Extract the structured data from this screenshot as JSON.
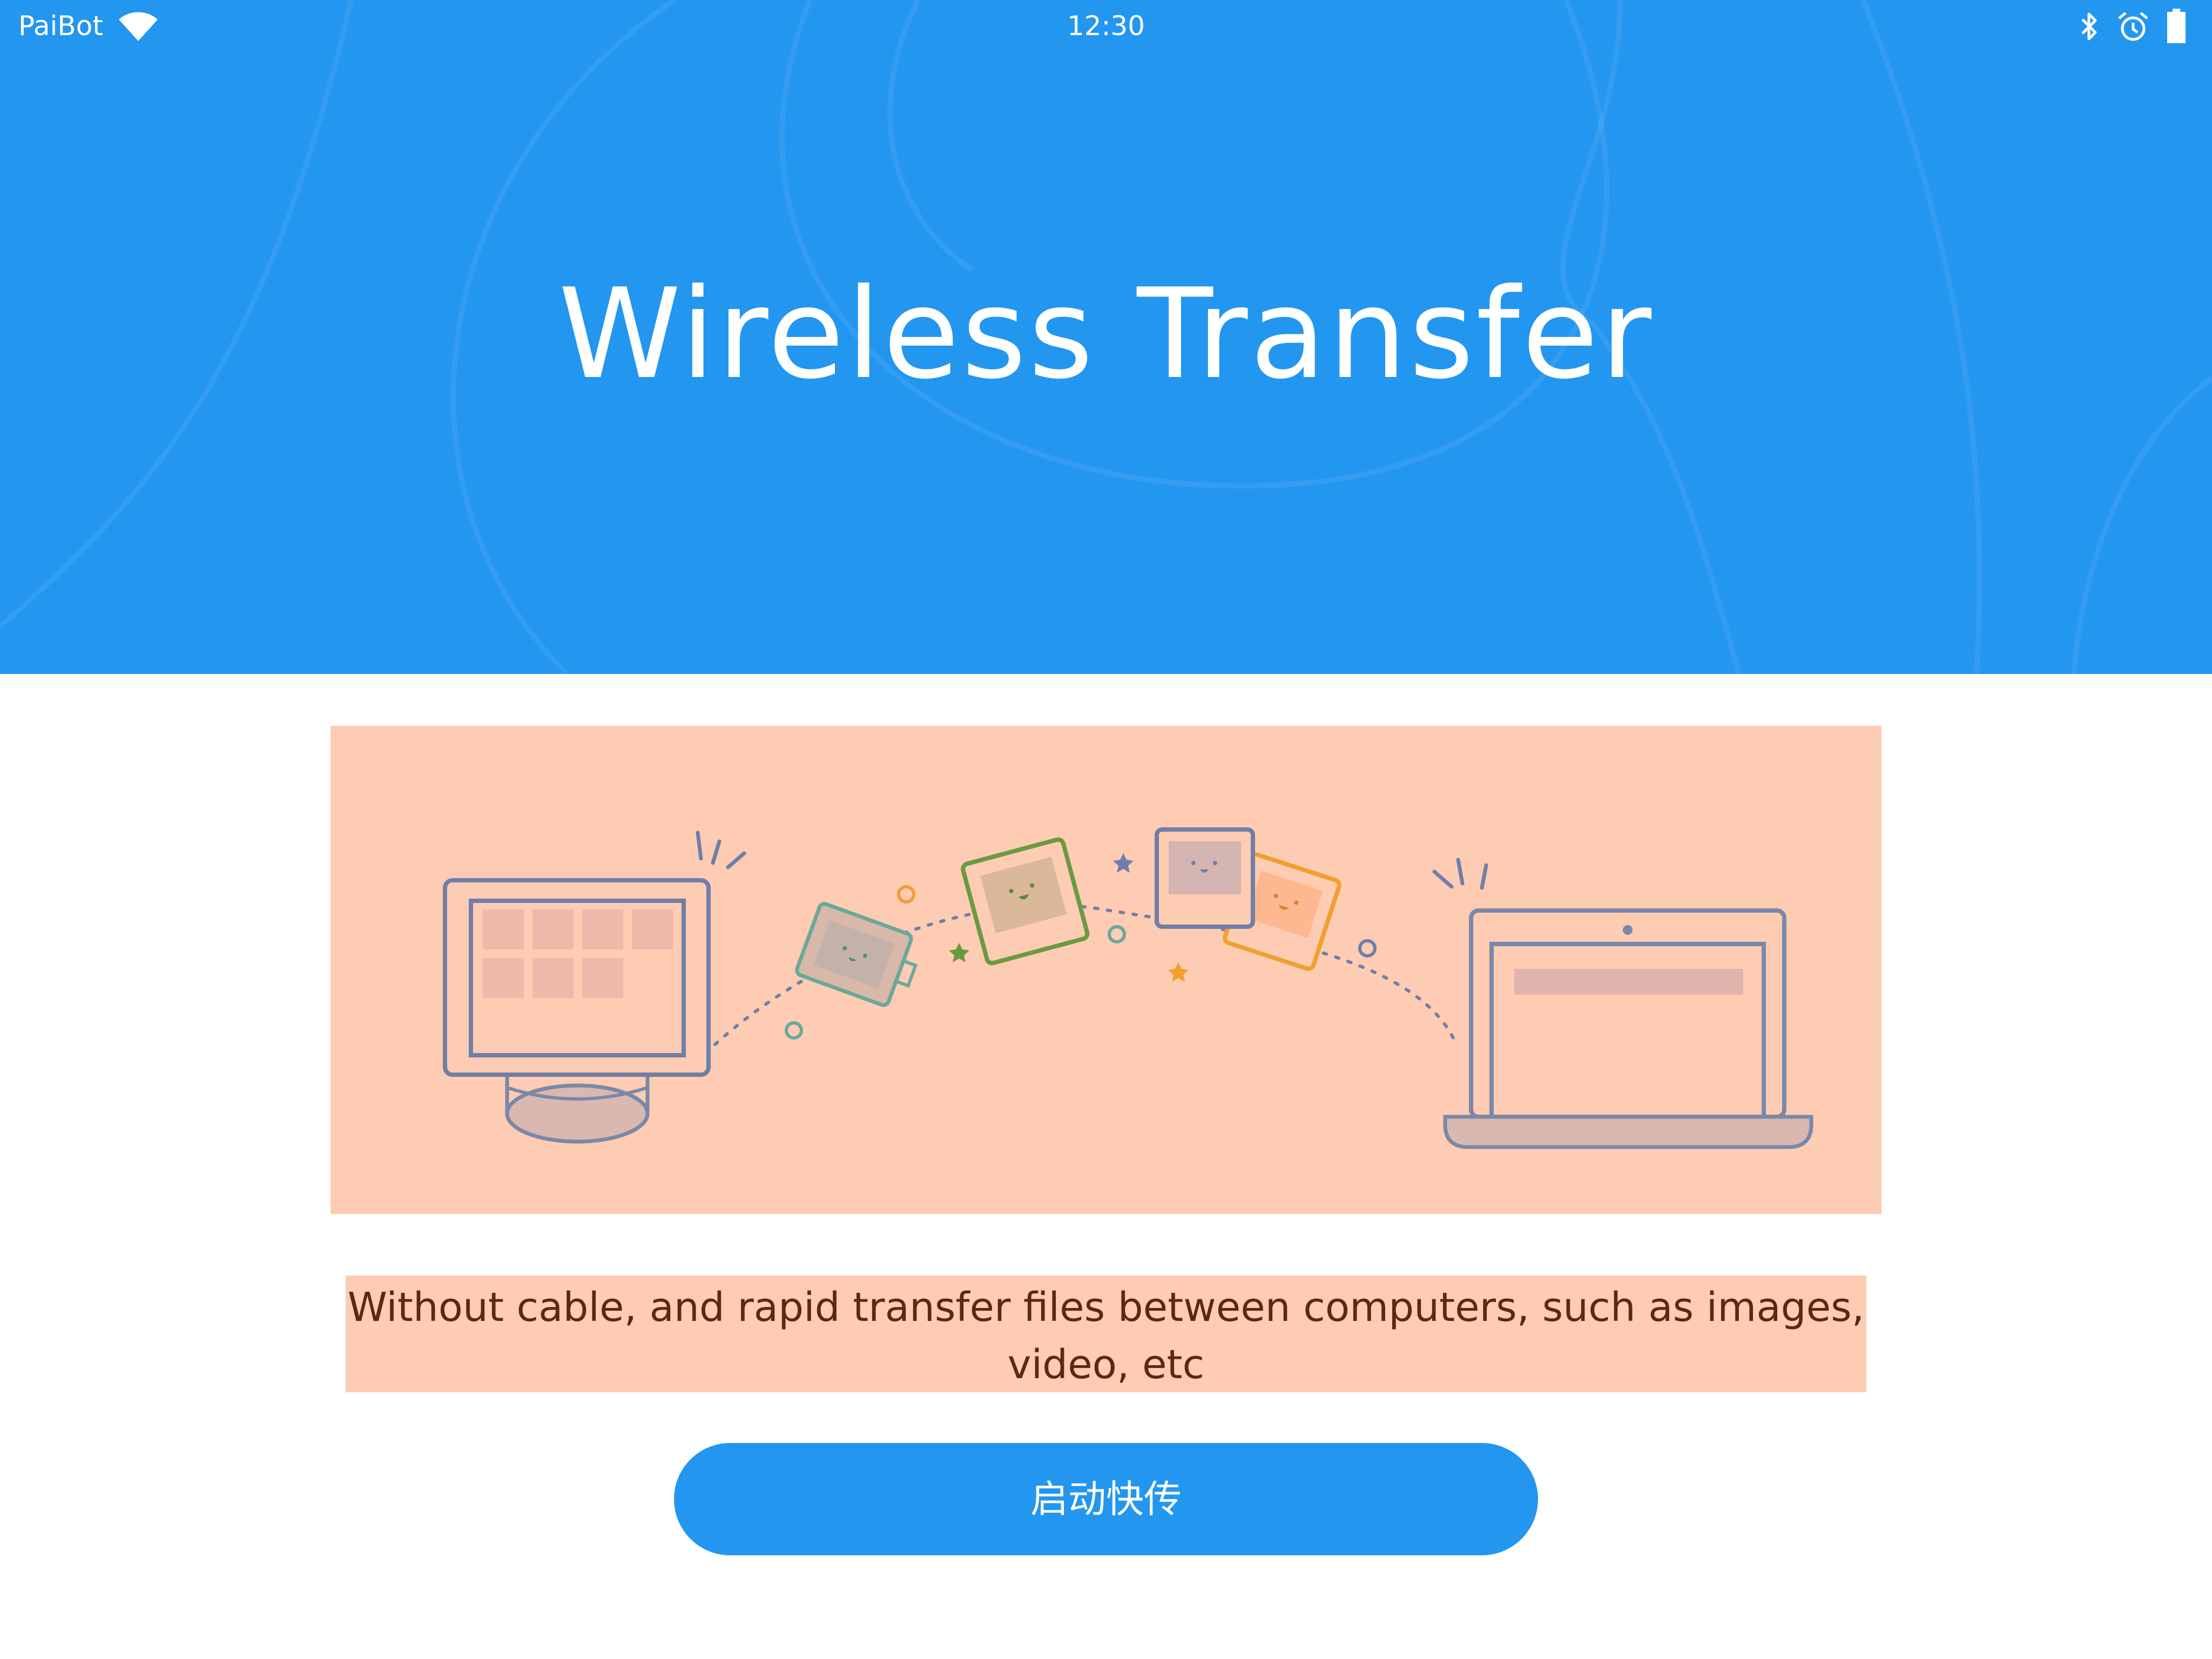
{
  "status_bar": {
    "carrier": "PaiBot",
    "time": "12:30",
    "icons": [
      "wifi-icon",
      "bluetooth-icon",
      "alarm-icon",
      "battery-icon"
    ]
  },
  "header": {
    "title": "Wireless Transfer"
  },
  "illustration": {
    "icons": [
      "desktop-computer-icon",
      "photo-card-icon",
      "photo-card-icon",
      "photo-card-icon",
      "photo-card-icon",
      "laptop-icon"
    ]
  },
  "description": {
    "text": "Without cable, and rapid transfer files between computers, such as images, video, etc"
  },
  "actions": {
    "start_label": "启动快传"
  },
  "colors": {
    "primary_blue": "#2396f0",
    "illustration_bg": "#fecbb3",
    "description_text": "#5a2a10",
    "white": "#ffffff"
  }
}
